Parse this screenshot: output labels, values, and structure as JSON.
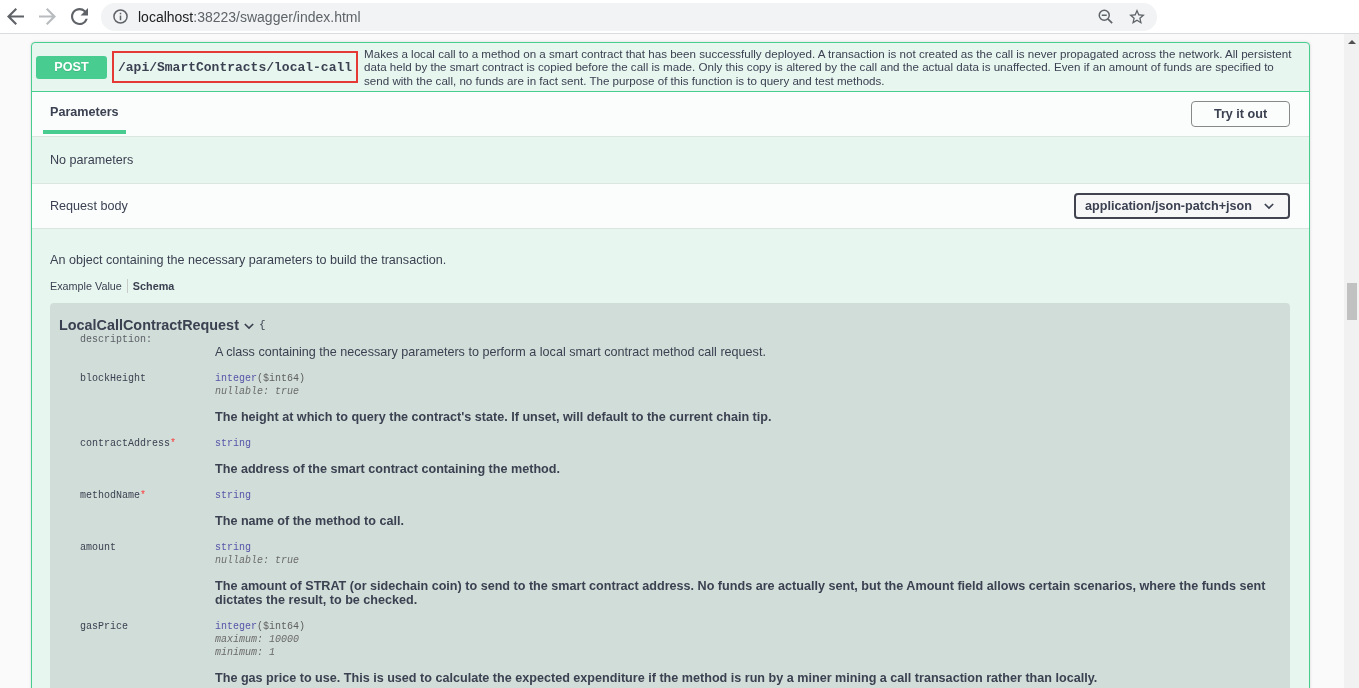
{
  "browser": {
    "nav_buttons": [
      {
        "kind": "back",
        "disabled": false
      },
      {
        "kind": "forward",
        "disabled": true
      },
      {
        "kind": "reload",
        "disabled": false
      }
    ],
    "address": {
      "host": "localhost",
      "path": ":38223/swagger/index.html"
    }
  },
  "operation": {
    "method": "POST",
    "path": "/api/SmartContracts/local-call",
    "highlighted": true,
    "description": "Makes a local call to a method on a smart contract that has been successfully deployed. A transaction is not created as the call is never propagated across the network. All persistent data held by the smart contract is copied before the call is made. Only this copy is altered by the call and the actual data is unaffected. Even if an amount of funds are specified to send with the call, no funds are in fact sent. The purpose of this function is to query and test methods."
  },
  "tabs": [
    {
      "label": "Parameters",
      "selected": true
    }
  ],
  "try_button": "Try it out",
  "parameters_message": "No parameters",
  "request_body": {
    "label": "Request body",
    "content_type": "application/json-patch+json",
    "description": "An object containing the necessary parameters to build the transaction.",
    "view_tabs": [
      {
        "label": "Example Value",
        "selected": false
      },
      {
        "label": "Schema",
        "selected": true
      }
    ]
  },
  "model": {
    "name": "LocalCallContractRequest",
    "expanded": true,
    "brace": "{",
    "description_label": "description:",
    "description": "A class containing the necessary parameters to perform a local smart contract method call request.",
    "required_mark": "*",
    "properties": [
      {
        "name": "blockHeight",
        "required": false,
        "type": "integer",
        "format": "($int64)",
        "constraints": [
          "nullable: true"
        ],
        "description": "The height at which to query the contract's state. If unset, will default to the current chain tip."
      },
      {
        "name": "contractAddress",
        "required": true,
        "type": "string",
        "description": "The address of the smart contract containing the method."
      },
      {
        "name": "methodName",
        "required": true,
        "type": "string",
        "description": "The name of the method to call."
      },
      {
        "name": "amount",
        "required": false,
        "type": "string",
        "constraints": [
          "nullable: true"
        ],
        "description": "The amount of STRAT (or sidechain coin) to send to the smart contract address. No funds are actually sent, but the Amount field allows certain scenarios, where the funds sent dictates the result, to be checked."
      },
      {
        "name": "gasPrice",
        "required": false,
        "type": "integer",
        "format": "($int64)",
        "constraints": [
          "maximum: 10000",
          "minimum: 1"
        ],
        "description": "The gas price to use. This is used to calculate the expected expenditure if the method is run by a miner mining a call transaction rather than locally."
      }
    ]
  }
}
